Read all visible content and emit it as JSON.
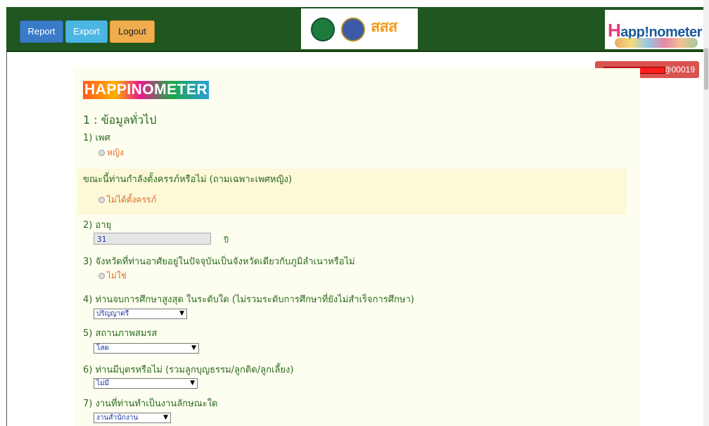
{
  "topbar": {
    "report_label": "Report",
    "export_label": "Export",
    "logout_label": "Logout",
    "partner_logo_text": "สสส",
    "happ_logo_text_h": "H",
    "happ_logo_text_rest": "app",
    "happ_logo_text_end": "nometer"
  },
  "user": {
    "id_suffix": "@00019"
  },
  "form": {
    "title": "HAPPINOMETER",
    "section_1": "1 : ข้อมูลทั่วไป",
    "q1": "1) เพศ",
    "q1_answer": "หญิง",
    "q1b": "ขณะนี้ท่านกำลังตั้งครรภ์หรือไม่ (ถามเฉพาะเพศหญิง)",
    "q1b_answer": "ไม่ได้ตั้งครรภ์",
    "q2": "2) อายุ",
    "q2_value": "31",
    "q2_unit": "ปี",
    "q3": "3) จังหวัดที่ท่านอาศัยอยู่ในปัจจุบันเป็นจังหวัดเดียวกับภูมิลำเนาหรือไม่",
    "q3_answer": "ไม่ใช่",
    "q4": "4) ท่านจบการศึกษาสูงสุด ในระดับใด (ไม่รวมระดับการศึกษาที่ยังไม่สำเร็จการศึกษา)",
    "q4_value": "ปริญญาตรี",
    "q5": "5) สถานภาพสมรส",
    "q5_value": "โสด",
    "q6": "6) ท่านมีบุตรหรือไม่ (รวมลูกบุญธรรม/ลูกติด/ลูกเลี้ยง)",
    "q6_value": "ไม่มี",
    "q7": "7) งานที่ท่านทำเป็นงานลักษณะใด",
    "q7_value": "งานสำนักงาน"
  }
}
